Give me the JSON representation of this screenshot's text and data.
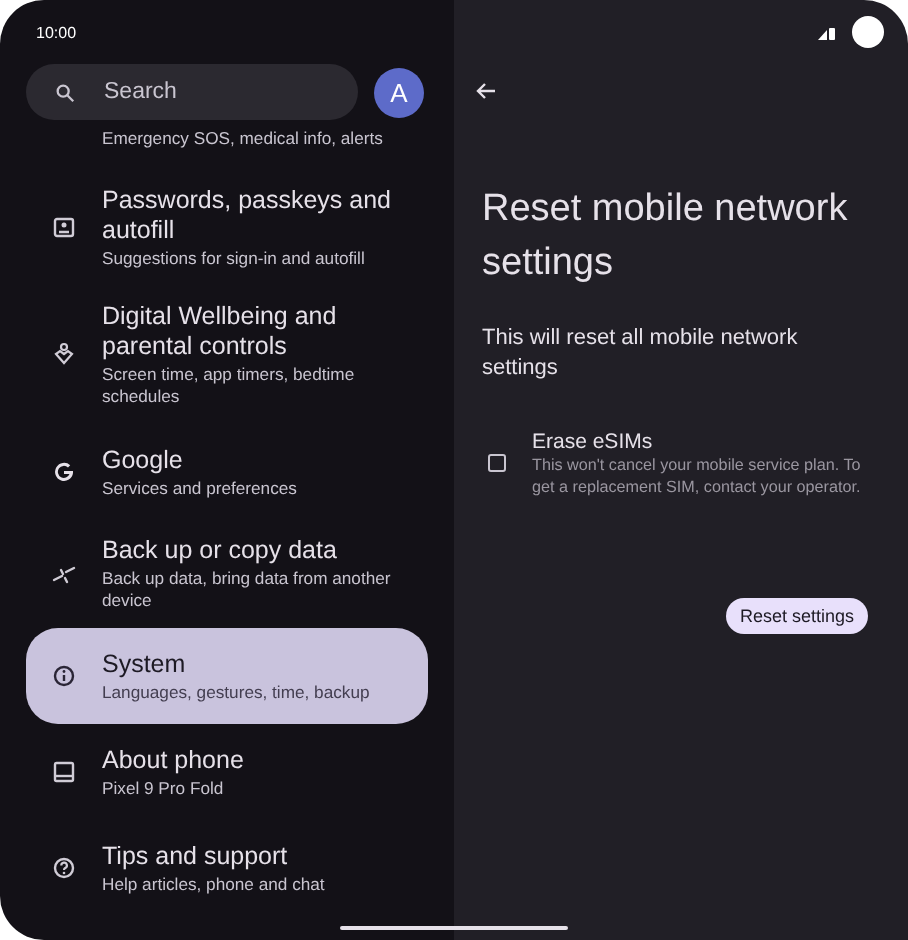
{
  "status_bar": {
    "time": "10:00"
  },
  "search": {
    "placeholder": "Search"
  },
  "avatar": {
    "letter": "A"
  },
  "settings_items": [
    {
      "subtitle": "Emergency SOS, medical info, alerts",
      "selected": false
    },
    {
      "title": "Passwords, passkeys and autofill",
      "subtitle": "Suggestions for sign-in and autofill",
      "selected": false
    },
    {
      "title": "Digital Wellbeing and parental controls",
      "subtitle": "Screen time, app timers, bedtime schedules",
      "selected": false
    },
    {
      "title": "Google",
      "subtitle": "Services and preferences",
      "selected": false
    },
    {
      "title": "Back up or copy data",
      "subtitle": "Back up data, bring data from another device",
      "selected": false
    },
    {
      "title": "System",
      "subtitle": "Languages, gestures, time, backup",
      "selected": true
    },
    {
      "title": "About phone",
      "subtitle": "Pixel 9 Pro Fold",
      "selected": false
    },
    {
      "title": "Tips and support",
      "subtitle": "Help articles, phone and chat",
      "selected": false
    }
  ],
  "detail": {
    "title": "Reset mobile network settings",
    "description": "This will reset all mobile network settings",
    "option": {
      "label": "Erase eSIMs",
      "description": "This won't cancel your mobile service plan. To get a replacement SIM, contact your operator.",
      "checked": false
    },
    "button": "Reset settings"
  }
}
